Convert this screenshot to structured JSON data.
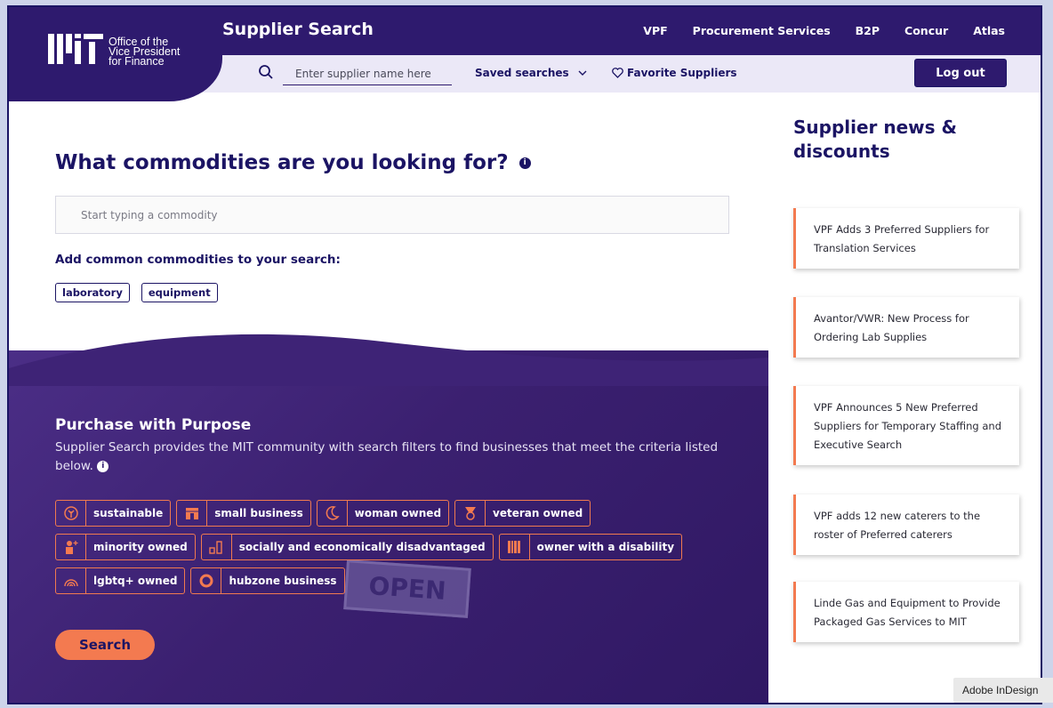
{
  "header": {
    "logo": {
      "line1": "Office of the",
      "line2": "Vice President",
      "line3": "for Finance"
    },
    "site_title": "Supplier Search",
    "nav": [
      "VPF",
      "Procurement Services",
      "B2P",
      "Concur",
      "Atlas"
    ],
    "search_placeholder": "Enter supplier name here",
    "saved_searches": "Saved searches",
    "favorites": "Favorite Suppliers",
    "logout": "Log out"
  },
  "main": {
    "heading": "What commodities are you looking for?",
    "info_glyph": "i",
    "commodity_placeholder": "Start typing a commodity",
    "add_common_label": "Add common commodities to your search:",
    "common_chips": [
      "laboratory",
      "equipment"
    ],
    "purpose_title": "Purchase with Purpose",
    "purpose_desc": "Supplier Search provides the MIT community with search filters to find businesses that meet the criteria listed below.",
    "filters": [
      {
        "label": "sustainable",
        "icon": "leaf-icon"
      },
      {
        "label": "small business",
        "icon": "storefront-icon"
      },
      {
        "label": "woman owned",
        "icon": "moon-icon"
      },
      {
        "label": "veteran owned",
        "icon": "medal-icon"
      },
      {
        "label": "minority owned",
        "icon": "person-plus-icon"
      },
      {
        "label": "socially and economically disadvantaged",
        "icon": "bar-chart-icon"
      },
      {
        "label": "owner with a disability",
        "icon": "barcode-icon"
      },
      {
        "label": "lgbtq+ owned",
        "icon": "rainbow-icon"
      },
      {
        "label": "hubzone business",
        "icon": "hub-icon"
      }
    ],
    "open_sign": "OPEN",
    "search_button": "Search"
  },
  "sidebar": {
    "title": "Supplier news & discounts",
    "news": [
      "VPF Adds 3 Preferred Suppliers for Translation Services",
      "Avantor/VWR: New Process for Ordering Lab Supplies",
      "VPF Announces 5 New Preferred Suppliers for Temporary Staffing and Executive Search",
      "VPF adds 12 new caterers to the roster of Preferred caterers",
      "Linde Gas and Equipment to Provide Packaged Gas Services to MIT"
    ]
  },
  "overlay": {
    "toast": "Adobe InDesign"
  },
  "colors": {
    "brand": "#2e1a6e",
    "accent": "#f37a50",
    "subbar": "#ebe8f7"
  }
}
